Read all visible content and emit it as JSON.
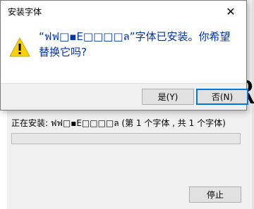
{
  "dialog": {
    "title": "安装字体",
    "close_label": "✕",
    "message": "“ฟฟ□▪E□□□□ล”字体已安装。你希望替换它吗?",
    "yes_label": "是(Y)",
    "no_label": "否(N)",
    "icon": "warning-icon",
    "accent_color": "#0033aa",
    "warning_color": "#f8d300"
  },
  "installer": {
    "status_text": "正在安装: ฟฟ□▪E□□□□ล (第 1 个字体 , 共 1 个字体)",
    "progress_fraction": 0,
    "stop_label": "停止",
    "background_glyph": "R"
  }
}
